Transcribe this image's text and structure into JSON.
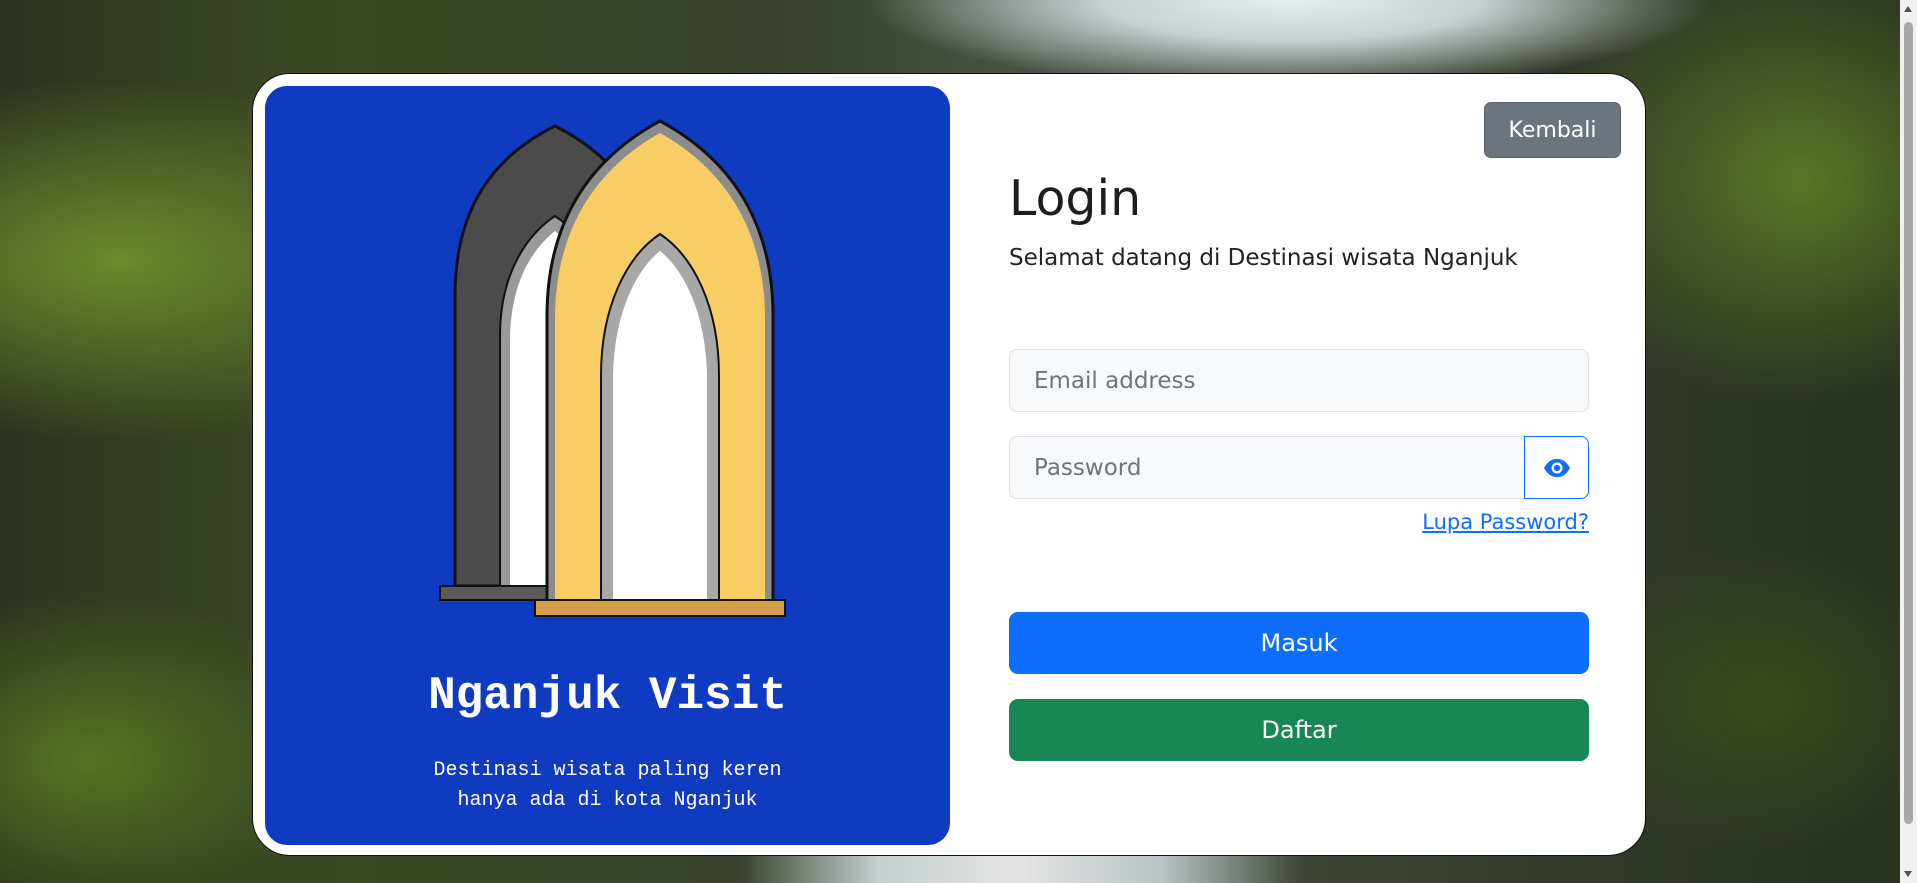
{
  "brand": {
    "title": "Nganjuk Visit",
    "tagline_line1": "Destinasi wisata paling keren",
    "tagline_line2": "hanya ada di kota Nganjuk"
  },
  "header": {
    "back_label": "Kembali"
  },
  "login": {
    "title": "Login",
    "subtitle": "Selamat datang di Destinasi wisata Nganjuk",
    "email_placeholder": "Email address",
    "password_placeholder": "Password",
    "forgot_label": "Lupa Password?",
    "submit_label": "Masuk",
    "register_label": "Daftar"
  },
  "icons": {
    "password_toggle": "eye-icon",
    "logo": "arch-gate-logo"
  },
  "colors": {
    "brand_panel": "#0f3bc0",
    "primary": "#0d6efd",
    "success": "#198754",
    "secondary": "#6c757d",
    "arch_gold": "#f7cd64",
    "arch_gray": "#4b4b4b"
  }
}
